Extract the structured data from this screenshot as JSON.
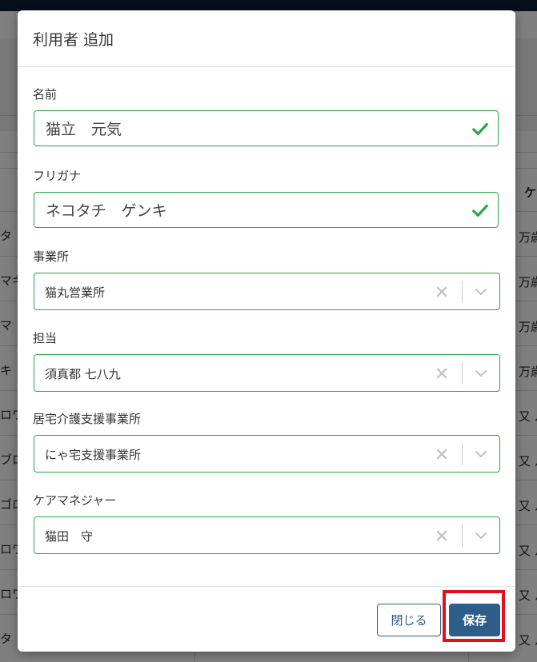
{
  "background": {
    "column_header": "ケ",
    "rows": [
      {
        "name": "タ",
        "col": "万歳"
      },
      {
        "name": "マキ",
        "col": "万歳"
      },
      {
        "name": "マ",
        "col": "万歳"
      },
      {
        "name": "キ",
        "col": "万歳"
      },
      {
        "name": "ロワ",
        "col": "又 ル"
      },
      {
        "name": "ブロ",
        "col": "又 ル"
      },
      {
        "name": "ゴロ",
        "col": "又 ル"
      },
      {
        "name": "ロワ",
        "col": "又 ル"
      },
      {
        "name": "ロワ",
        "col": "又 ル"
      },
      {
        "name": "タ",
        "col": "又 ル"
      }
    ]
  },
  "modal": {
    "title": "利用者 追加",
    "fields": {
      "name": {
        "label": "名前",
        "value": "猫立　元気"
      },
      "furigana": {
        "label": "フリガナ",
        "value": "ネコタチ　ゲンキ"
      },
      "office": {
        "label": "事業所",
        "value": "猫丸営業所"
      },
      "staff": {
        "label": "担当",
        "value": "須真都 七八九"
      },
      "home_care_office": {
        "label": "居宅介護支援事業所",
        "value": "にゃ宅支援事業所"
      },
      "care_manager": {
        "label": "ケアマネジャー",
        "value": "猫田　守"
      }
    },
    "buttons": {
      "close": "閉じる",
      "save": "保存"
    }
  },
  "colors": {
    "valid": "#28a745",
    "primary": "#2e5d8a",
    "highlight": "#e0101e",
    "topbar": "#0d2138"
  }
}
